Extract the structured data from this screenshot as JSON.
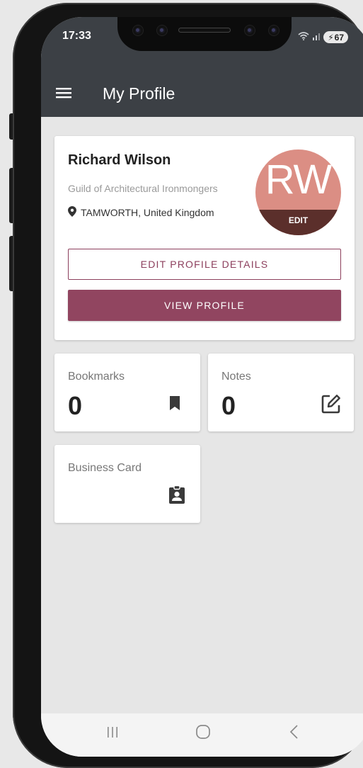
{
  "status_bar": {
    "time": "17:33",
    "battery": "67"
  },
  "app_bar": {
    "title": "My Profile"
  },
  "profile": {
    "name": "Richard Wilson",
    "organisation": "Guild of Architectural Ironmongers",
    "location": "TAMWORTH, United Kingdom",
    "avatar_initials": "RW",
    "avatar_edit_label": "EDIT",
    "avatar_color": "#db8e84"
  },
  "actions": {
    "edit_profile_label": "EDIT PROFILE DETAILS",
    "view_profile_label": "VIEW PROFILE",
    "accent_color": "#914560"
  },
  "tiles": [
    {
      "label": "Bookmarks",
      "count": "0",
      "icon": "bookmark-icon"
    },
    {
      "label": "Notes",
      "count": "0",
      "icon": "edit-note-icon"
    },
    {
      "label": "Business Card",
      "icon": "contact-badge-icon"
    }
  ],
  "nav_bar": {
    "buttons": [
      "recent-apps",
      "home",
      "back"
    ]
  }
}
